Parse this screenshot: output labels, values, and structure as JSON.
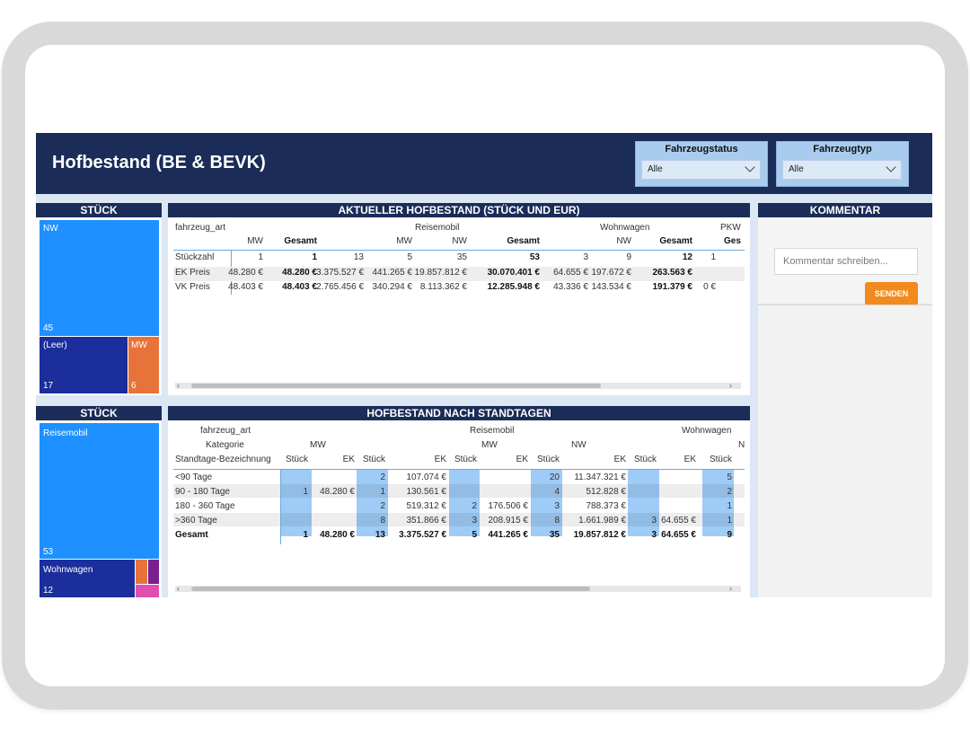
{
  "title": "Hofbestand (BE & BEVK)",
  "filters": [
    {
      "label": "Fahrzeugstatus",
      "value": "Alle"
    },
    {
      "label": "Fahrzeugtyp",
      "value": "Alle"
    }
  ],
  "panels": {
    "stueck1": "STÜCK",
    "aktuell": "AKTUELLER HOFBESTAND (STÜCK UND EUR)",
    "kommentar": "KOMMENTAR",
    "stueck2": "STÜCK",
    "standtage": "HOFBESTAND NACH STANDTAGEN"
  },
  "treemap1": {
    "nw": {
      "label": "NW",
      "value": "45"
    },
    "leer": {
      "label": "(Leer)",
      "value": "17"
    },
    "mw": {
      "label": "MW",
      "value": "6"
    }
  },
  "treemap2": {
    "reisemobil": {
      "label": "Reisemobil",
      "value": "53"
    },
    "wohnwagen": {
      "label": "Wohnwagen",
      "value": "12"
    }
  },
  "matrix1": {
    "row_header": "fahrzeug_art",
    "groups": [
      "Reisemobil",
      "Wohnwagen",
      "PKW"
    ],
    "cols": [
      "MW",
      "Gesamt",
      "MW",
      "NW",
      "Gesamt",
      "NW",
      "Gesamt"
    ],
    "rows": [
      {
        "label": "Stückzahl",
        "values": [
          "1",
          "1",
          "13",
          "5",
          "35",
          "53",
          "3",
          "9",
          "12",
          "1"
        ]
      },
      {
        "label": "EK Preis",
        "values": [
          "48.280 €",
          "48.280 €",
          "3.375.527 €",
          "441.265 €",
          "19.857.812 €",
          "30.070.401 €",
          "64.655 €",
          "197.672 €",
          "263.563 €",
          ""
        ]
      },
      {
        "label": "VK Preis",
        "values": [
          "48.403 €",
          "48.403 €",
          "2.765.456 €",
          "340.294 €",
          "8.113.362 €",
          "12.285.948 €",
          "43.336 €",
          "143.534 €",
          "191.379 €",
          "0 €"
        ]
      }
    ]
  },
  "comment": {
    "placeholder": "Kommentar schreiben...",
    "send": "SENDEN"
  },
  "matrix2": {
    "h1": "fahrzeug_art",
    "h2": "Kategorie",
    "h3": "Standtage-Bezeichnung",
    "g_reisemobil": "Reisemobil",
    "g_wohnwagen": "Wohnwagen",
    "cat_mw1": "MW",
    "cat_mw2": "MW",
    "cat_nw": "NW",
    "cat_nw2": "N",
    "sub": [
      "Stück",
      "EK",
      "Stück",
      "EK",
      "Stück",
      "EK",
      "Stück",
      "EK",
      "Stück",
      "EK",
      "Stück"
    ],
    "rows": [
      {
        "label": "<90 Tage",
        "values": [
          "",
          "",
          "2",
          "107.074 €",
          "",
          "",
          "20",
          "11.347.321 €",
          "",
          "",
          "5"
        ]
      },
      {
        "label": "90 - 180 Tage",
        "values": [
          "1",
          "48.280 €",
          "1",
          "130.561 €",
          "",
          "",
          "4",
          "512.828 €",
          "",
          "",
          "2"
        ]
      },
      {
        "label": "180 - 360 Tage",
        "values": [
          "",
          "",
          "2",
          "519.312 €",
          "2",
          "176.506 €",
          "3",
          "788.373 €",
          "",
          "",
          "1"
        ]
      },
      {
        "label": ">360 Tage",
        "values": [
          "",
          "",
          "8",
          "351.866 €",
          "3",
          "208.915 €",
          "8",
          "1.661.989 €",
          "3",
          "64.655 €",
          "1"
        ]
      },
      {
        "label": "Gesamt",
        "values": [
          "1",
          "48.280 €",
          "13",
          "3.375.527 €",
          "5",
          "441.265 €",
          "35",
          "19.857.812 €",
          "3",
          "64.655 €",
          "9"
        ]
      }
    ]
  },
  "colors": {
    "navy": "#1a2c57",
    "treemap_blue": "#1e90ff",
    "treemap_dark": "#1b2e9c",
    "treemap_orange": "#e8733a",
    "highlight": "#9fcbf7",
    "send": "#f28a1c"
  }
}
